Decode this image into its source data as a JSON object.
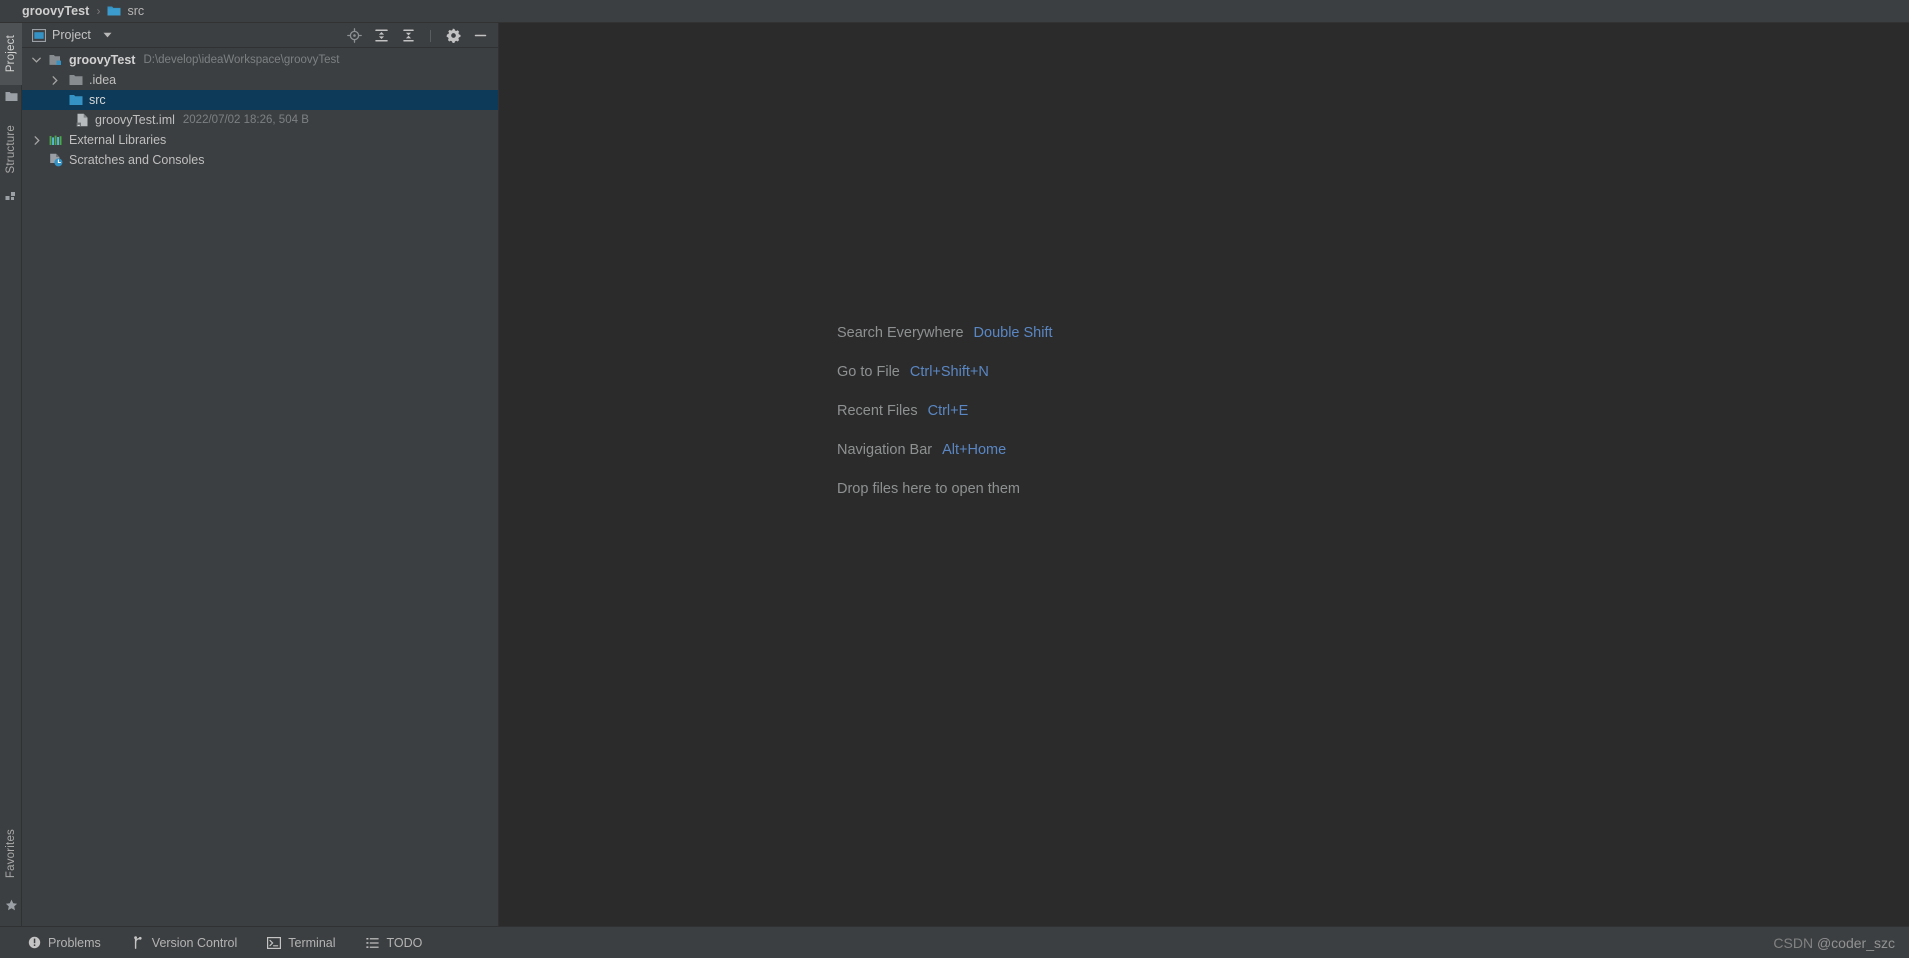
{
  "breadcrumb": {
    "root": "groovyTest",
    "separator": "›",
    "leaf": "src",
    "leaf_icon": "folder-icon"
  },
  "stripe": {
    "left_top": [
      {
        "label": "Project",
        "icon": "project-window-icon",
        "active": true
      },
      {
        "label": "",
        "icon": "folder-icon",
        "active": false
      },
      {
        "label": "Structure",
        "icon": "structure-icon",
        "active": false
      },
      {
        "label": "",
        "icon": "structure-blocks-icon",
        "active": false
      }
    ],
    "left_bottom": [
      {
        "label": "Favorites",
        "icon": "star-icon",
        "active": false
      }
    ]
  },
  "project_panel": {
    "title": "Project",
    "title_icon": "project-view-icon",
    "dropdown_icon": "chevron-down-icon",
    "tools": [
      {
        "name": "locate-icon",
        "title": "Select Opened File"
      },
      {
        "name": "expand-all-icon",
        "title": "Expand All"
      },
      {
        "name": "collapse-all-icon",
        "title": "Collapse All"
      },
      {
        "name": "gear-icon",
        "title": "Settings"
      },
      {
        "name": "minimize-icon",
        "title": "Hide"
      }
    ],
    "tree": [
      {
        "label": "groovyTest",
        "detail": "D:\\develop\\ideaWorkspace\\groovyTest",
        "icon": "module-folder-icon",
        "arrow": "expanded",
        "indent": 0,
        "bold": true,
        "selected": false
      },
      {
        "label": ".idea",
        "detail": "",
        "icon": "folder-icon",
        "arrow": "collapsed",
        "indent": 1,
        "bold": false,
        "selected": false
      },
      {
        "label": "src",
        "detail": "",
        "icon": "source-folder-icon",
        "arrow": "none",
        "indent": 1,
        "bold": false,
        "selected": true
      },
      {
        "label": "groovyTest.iml",
        "detail": "2022/07/02 18:26, 504 B",
        "icon": "iml-file-icon",
        "arrow": "none",
        "indent": 1,
        "bold": false,
        "selected": false
      },
      {
        "label": "External Libraries",
        "detail": "",
        "icon": "libraries-icon",
        "arrow": "collapsed",
        "indent": 0,
        "bold": false,
        "selected": false
      },
      {
        "label": "Scratches and Consoles",
        "detail": "",
        "icon": "scratches-icon",
        "arrow": "none",
        "indent": 0,
        "bold": false,
        "selected": false
      }
    ]
  },
  "editor": {
    "hints": [
      {
        "name": "Search Everywhere",
        "key": "Double Shift"
      },
      {
        "name": "Go to File",
        "key": "Ctrl+Shift+N"
      },
      {
        "name": "Recent Files",
        "key": "Ctrl+E"
      },
      {
        "name": "Navigation Bar",
        "key": "Alt+Home"
      }
    ],
    "drop_text": "Drop files here to open them"
  },
  "statusbar": {
    "items": [
      {
        "label": "Problems",
        "icon": "problems-icon"
      },
      {
        "label": "Version Control",
        "icon": "branch-icon"
      },
      {
        "label": "Terminal",
        "icon": "terminal-icon"
      },
      {
        "label": "TODO",
        "icon": "todo-list-icon"
      }
    ],
    "watermark_prefix": "CSDN ",
    "watermark_handle": "@coder_szc"
  },
  "colors": {
    "panel_bg": "#3c3f41",
    "editor_bg": "#2b2b2b",
    "selection": "#0d3a58",
    "accent_blue": "#3592c4",
    "hint_key": "#5a87c4",
    "text": "#bbbbbb"
  }
}
